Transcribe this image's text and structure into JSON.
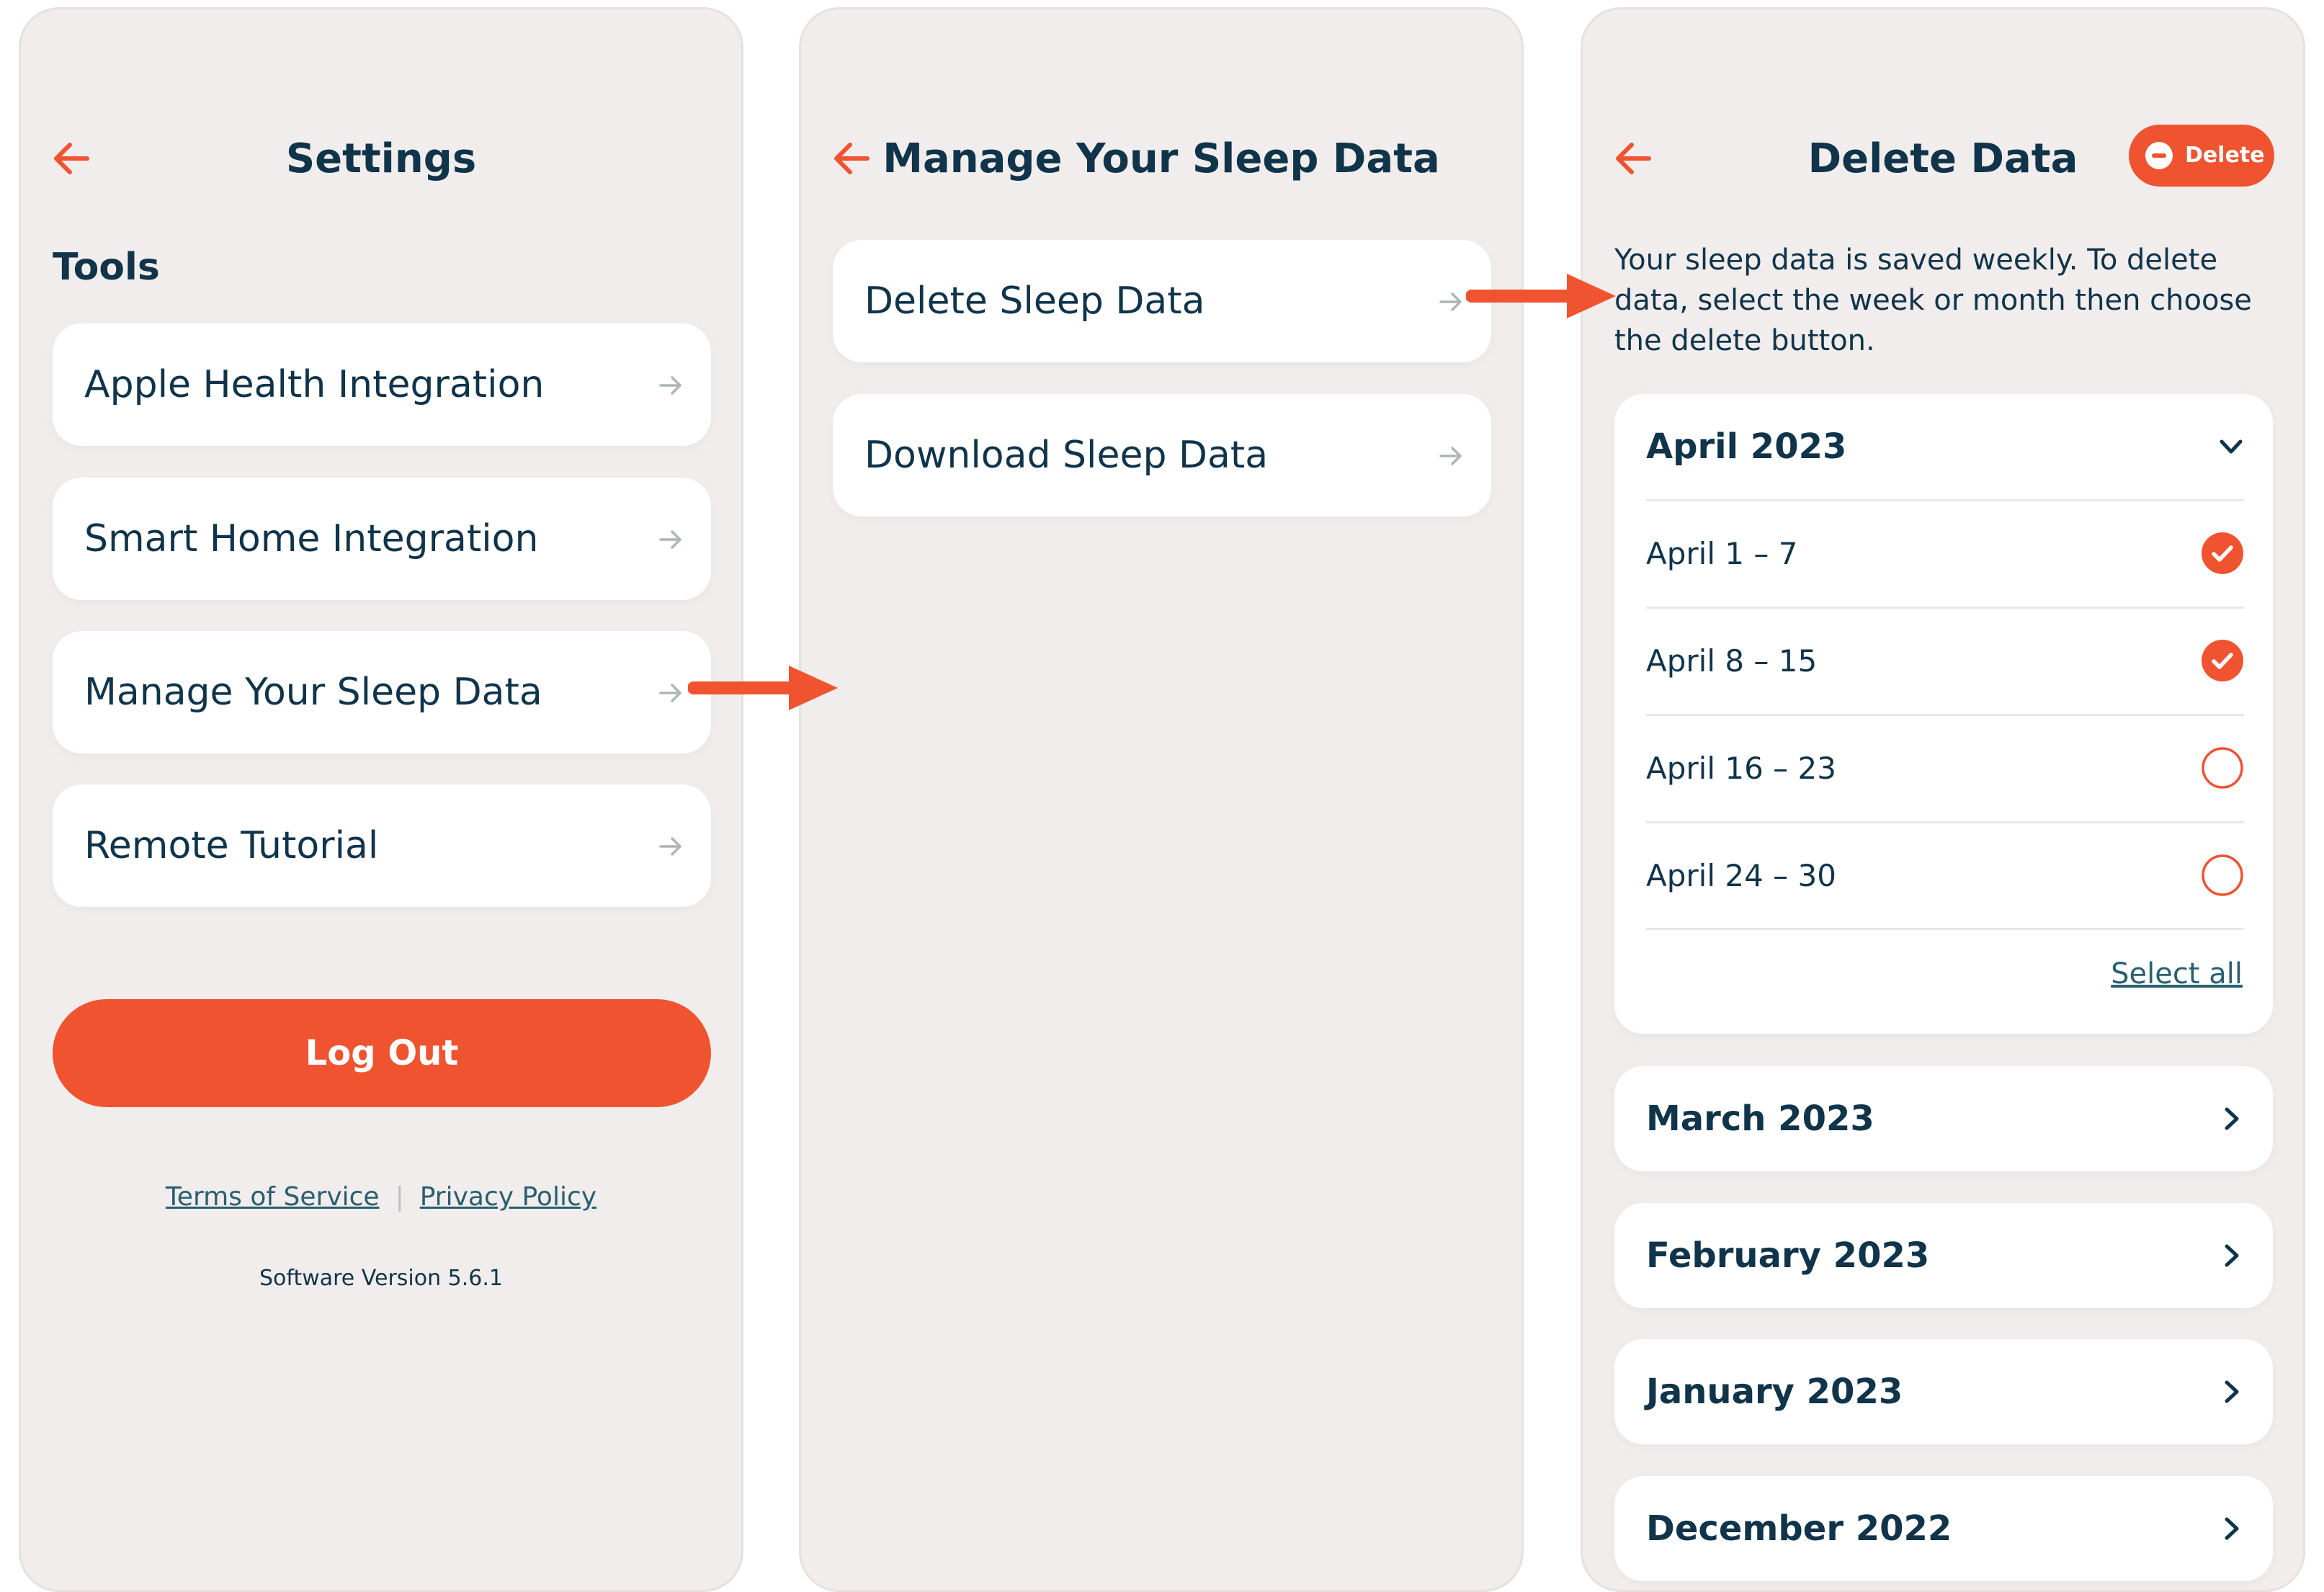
{
  "colors": {
    "accent": "#f05330",
    "text": "#10344a",
    "link": "#295f6f",
    "panel_background": "#f1edec",
    "card_background": "#ffffff"
  },
  "settings_screen": {
    "title": "Settings",
    "back_icon": "arrow-left-icon",
    "section_title": "Tools",
    "items": [
      {
        "label": "Apple Health Integration",
        "icon": "arrow-right-icon"
      },
      {
        "label": "Smart Home Integration",
        "icon": "arrow-right-icon"
      },
      {
        "label": "Manage Your Sleep Data",
        "icon": "arrow-right-icon"
      },
      {
        "label": "Remote Tutorial",
        "icon": "arrow-right-icon"
      }
    ],
    "logout_label": "Log Out",
    "terms_label": "Terms of Service",
    "separator": "|",
    "privacy_label": "Privacy Policy",
    "version_text": "Software Version 5.6.1"
  },
  "manage_screen": {
    "title": "Manage Your Sleep Data",
    "back_icon": "arrow-left-icon",
    "items": [
      {
        "label": "Delete Sleep Data",
        "icon": "arrow-right-icon"
      },
      {
        "label": "Download Sleep Data",
        "icon": "arrow-right-icon"
      }
    ]
  },
  "delete_screen": {
    "title": "Delete Data",
    "back_icon": "arrow-left-icon",
    "delete_button_label": "Delete",
    "delete_button_icon": "minus-circle-icon",
    "intro_lines": [
      "Your sleep data is saved weekly.  To delete",
      "data, select the week or month then choose",
      "the delete button."
    ],
    "expanded_month": {
      "label": "April 2023",
      "icon": "chevron-down-icon",
      "weeks": [
        {
          "label": "April 1 – 7",
          "selected": true
        },
        {
          "label": "April 8 – 15",
          "selected": true
        },
        {
          "label": "April 16 – 23",
          "selected": false
        },
        {
          "label": "April 24 – 30",
          "selected": false
        }
      ],
      "select_all_label": "Select all"
    },
    "collapsed_months": [
      {
        "label": "March 2023",
        "icon": "chevron-right-icon"
      },
      {
        "label": "February 2023",
        "icon": "chevron-right-icon"
      },
      {
        "label": "January 2023",
        "icon": "chevron-right-icon"
      },
      {
        "label": "December 2022",
        "icon": "chevron-right-icon"
      }
    ]
  }
}
